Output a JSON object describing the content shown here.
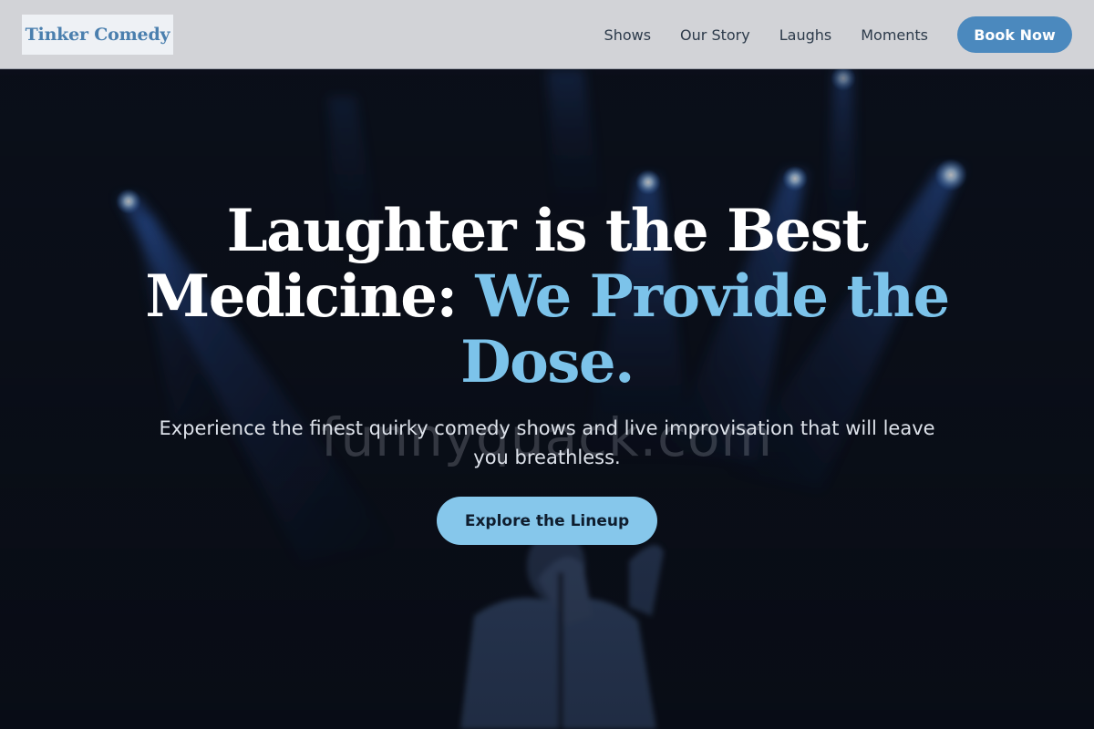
{
  "header": {
    "logo_text": "Tinker Comedy",
    "nav": [
      {
        "label": "Shows"
      },
      {
        "label": "Our Story"
      },
      {
        "label": "Laughs"
      },
      {
        "label": "Moments"
      }
    ],
    "book_button": "Book Now"
  },
  "hero": {
    "title_part1": "Laughter is the Best Medicine: ",
    "title_accent": "We Provide the Dose.",
    "subtitle": "Experience the finest quirky comedy shows and live improvisation that will leave you breathless.",
    "cta_label": "Explore the Lineup",
    "watermark": "funnyquack.com"
  },
  "colors": {
    "accent": "#7cc3ea",
    "brand_blue": "#4b89be",
    "header_bg": "#d2d3d7",
    "hero_bg": "#0c111c"
  }
}
